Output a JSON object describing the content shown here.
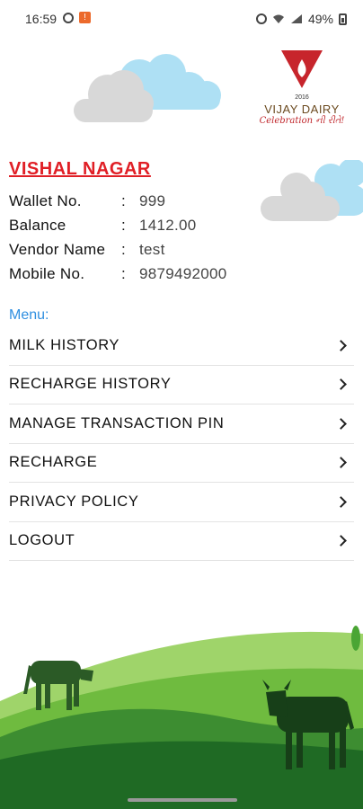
{
  "status_bar": {
    "time": "16:59",
    "battery": "49%"
  },
  "logo": {
    "name": "VIJAY DAIRY",
    "tagline": "Celebration ની રીતે!",
    "year": "2016"
  },
  "place": "VISHAL NAGAR",
  "info": [
    {
      "label": "Wallet No.",
      "value": "999"
    },
    {
      "label": "Balance",
      "value": "1412.00"
    },
    {
      "label": "Vendor Name",
      "value": "test"
    },
    {
      "label": "Mobile No.",
      "value": "9879492000"
    }
  ],
  "colon": ":",
  "menu": {
    "heading": "Menu:",
    "items": [
      {
        "label": "MILK HISTORY"
      },
      {
        "label": "RECHARGE HISTORY"
      },
      {
        "label": "MANAGE TRANSACTION PIN"
      },
      {
        "label": "RECHARGE"
      },
      {
        "label": "PRIVACY POLICY"
      },
      {
        "label": "LOGOUT"
      }
    ]
  },
  "colors": {
    "title_red": "#e01f26",
    "menu_blue": "#2f8fe0",
    "grass_light": "#7cc242",
    "grass_dark": "#2f7a2a"
  },
  "icons": [
    "chevron-right-icon",
    "cloud-icon",
    "cow-icon",
    "battery-icon"
  ]
}
